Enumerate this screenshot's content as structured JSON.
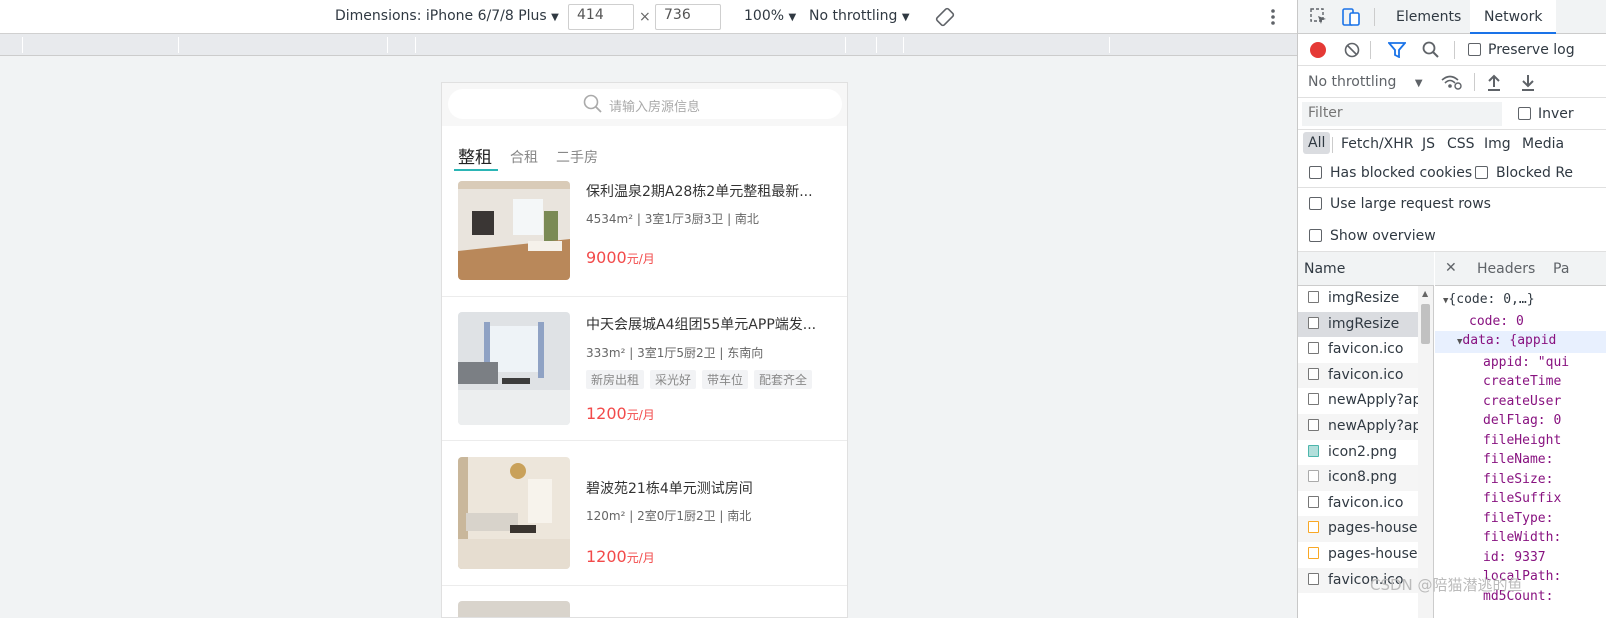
{
  "device_toolbar": {
    "dimensions_label": "Dimensions: iPhone 6/7/8 Plus",
    "width": "414",
    "times": "×",
    "height": "736",
    "zoom": "100%",
    "throttle": "No throttling"
  },
  "app": {
    "search_placeholder": "请输入房源信息",
    "tabs": [
      {
        "label": "整租",
        "active": true
      },
      {
        "label": "合租",
        "active": false
      },
      {
        "label": "二手房",
        "active": false
      }
    ],
    "houses": [
      {
        "title": "保利温泉2期A28栋2单元整租最新...",
        "meta": "4534m² | 3室1厅3厨3卫 | 南北",
        "tags": [],
        "price": "9000",
        "unit": "元/月"
      },
      {
        "title": "中天会展城A4组团55单元APP端发...",
        "meta": "333m² | 3室1厅5厨2卫 | 东南向",
        "tags": [
          "新房出租",
          "采光好",
          "带车位",
          "配套齐全"
        ],
        "price": "1200",
        "unit": "元/月"
      },
      {
        "title": "碧波苑21栋4单元测试房间",
        "meta": "120m² | 2室0厅1厨2卫 | 南北",
        "tags": [],
        "price": "1200",
        "unit": "元/月"
      }
    ]
  },
  "devtools": {
    "tabs": [
      "Elements",
      "Network"
    ],
    "active_tab": "Network",
    "preserve_log": "Preserve log",
    "throttle": "No throttling",
    "filter_placeholder": "Filter",
    "invert": "Inver",
    "type_filters": [
      "All",
      "Fetch/XHR",
      "JS",
      "CSS",
      "Img",
      "Media"
    ],
    "has_blocked_cookies": "Has blocked cookies",
    "blocked_requests": "Blocked Re",
    "use_large_rows": "Use large request rows",
    "show_overview": "Show overview",
    "name_header": "Name",
    "detail_tabs": [
      "Headers",
      "Pa"
    ],
    "requests": [
      "imgResize",
      "imgResize",
      "favicon.ico",
      "favicon.ico",
      "newApply?ap",
      "newApply?ap",
      "icon2.png",
      "icon8.png",
      "favicon.ico",
      "pages-house.",
      "pages-house.",
      "favicon.ico"
    ],
    "json_lines": [
      "{code: 0,…}",
      "code: 0",
      "data: {appid",
      "appid: \"qui",
      "createTime",
      "createUser",
      "delFlag: 0",
      "fileHeight",
      "fileName: ",
      "fileSize: ",
      "fileSuffix",
      "fileType: ",
      "fileWidth:",
      "id: 9337",
      "localPath:",
      "md5Count: "
    ]
  },
  "watermark": "CSDN @陪猫潜逃的鱼",
  "colors": {
    "accent": "#1a73e8",
    "price": "#f24a4a",
    "tab_underline": "#2bb5b5",
    "record": "#e53935"
  }
}
